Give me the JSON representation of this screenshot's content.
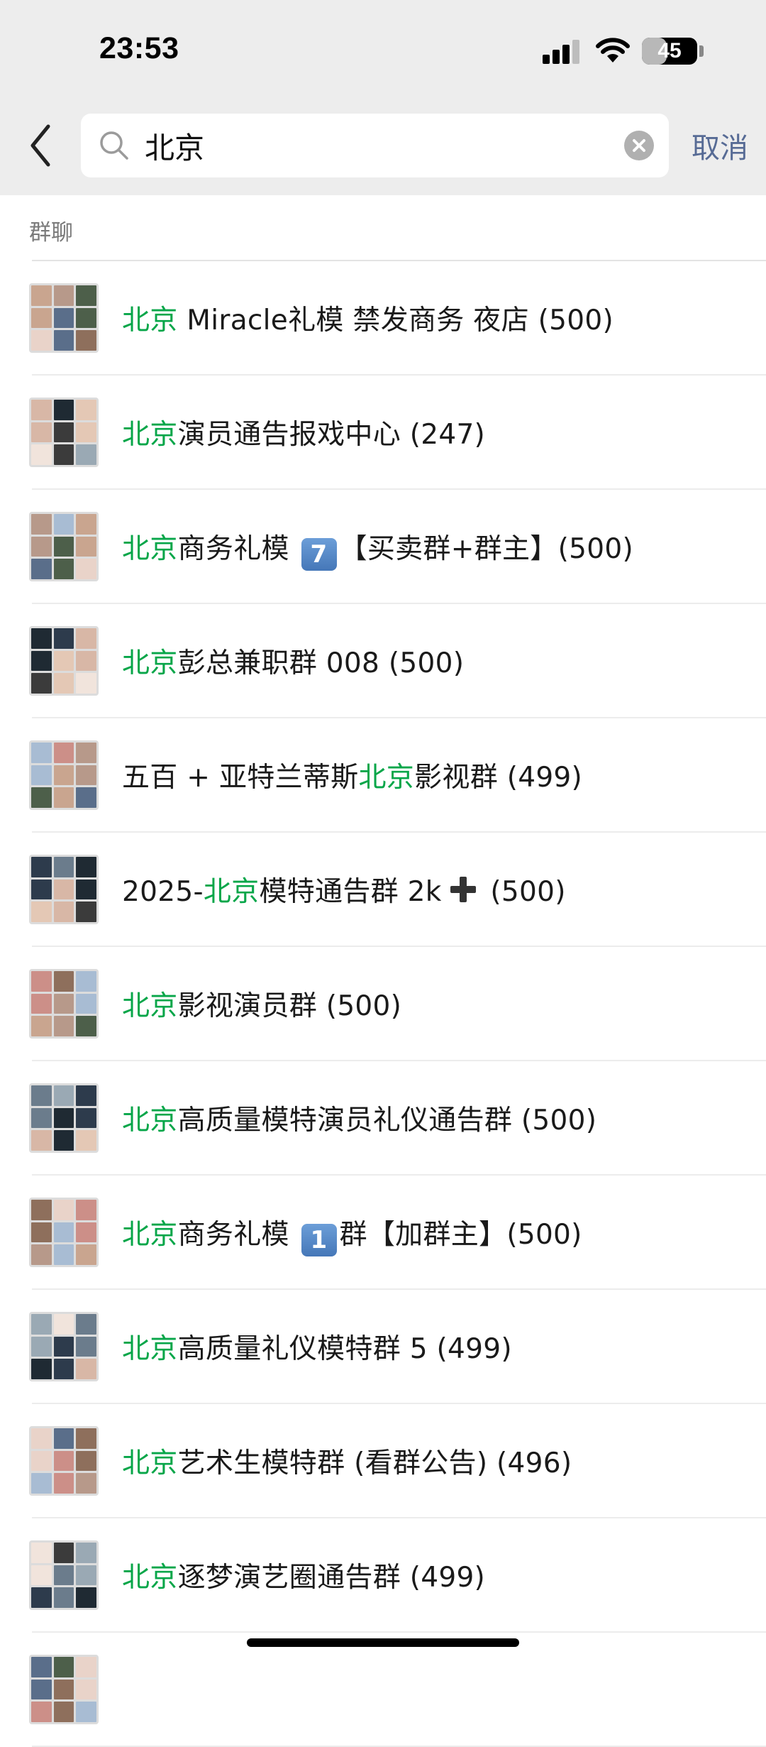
{
  "status_bar": {
    "time": "23:53",
    "battery": "45",
    "battery_level": 0.45
  },
  "search": {
    "query": "北京",
    "cancel_label": "取消"
  },
  "section": {
    "title": "群聊"
  },
  "results": [
    {
      "parts": [
        {
          "text": "北京",
          "hl": true
        },
        {
          "text": " Miracle礼模 禁发商务 夜店 (500)"
        }
      ]
    },
    {
      "parts": [
        {
          "text": "北京",
          "hl": true
        },
        {
          "text": "演员通告报戏中心 (247)"
        }
      ]
    },
    {
      "parts": [
        {
          "text": "北京",
          "hl": true
        },
        {
          "text": "商务礼模 "
        },
        {
          "badge": "7"
        },
        {
          "text": "【买卖群+群主】(500)"
        }
      ]
    },
    {
      "parts": [
        {
          "text": "北京",
          "hl": true
        },
        {
          "text": "彭总兼职群 008 (500)"
        }
      ]
    },
    {
      "parts": [
        {
          "text": "五百 + 亚特兰蒂斯"
        },
        {
          "text": "北京",
          "hl": true
        },
        {
          "text": "影视群 (499)"
        }
      ]
    },
    {
      "parts": [
        {
          "text": "2025-"
        },
        {
          "text": "北京",
          "hl": true
        },
        {
          "text": "模特通告群 2k"
        },
        {
          "plus": true
        },
        {
          "text": " (500)"
        }
      ]
    },
    {
      "parts": [
        {
          "text": "北京",
          "hl": true
        },
        {
          "text": "影视演员群 (500)"
        }
      ]
    },
    {
      "parts": [
        {
          "text": "北京",
          "hl": true
        },
        {
          "text": "高质量模特演员礼仪通告群 (500)"
        }
      ]
    },
    {
      "parts": [
        {
          "text": "北京",
          "hl": true
        },
        {
          "text": "商务礼模 "
        },
        {
          "badge": "1"
        },
        {
          "text": "群【加群主】(500)"
        }
      ]
    },
    {
      "parts": [
        {
          "text": "北京",
          "hl": true
        },
        {
          "text": "高质量礼仪模特群 5 (499)"
        }
      ]
    },
    {
      "parts": [
        {
          "text": "北京",
          "hl": true
        },
        {
          "text": "艺术生模特群 (看群公告) (496)"
        }
      ]
    },
    {
      "parts": [
        {
          "text": "北京",
          "hl": true
        },
        {
          "text": "逐梦演艺圈通告群 (499)"
        }
      ]
    },
    {
      "parts": []
    }
  ],
  "colors": {
    "highlight": "#07a649",
    "link": "#576b95",
    "avatar_palette": [
      "#c9a58f",
      "#3b3b3b",
      "#e9d3c9",
      "#6b7c8c",
      "#a8bcd3",
      "#d8b7a6",
      "#4d5f4a",
      "#f1e4dc",
      "#8e6f5c",
      "#2d3b4c",
      "#b7998a",
      "#e4c8b5",
      "#5a6e8a",
      "#9aa9b4",
      "#cc8f88",
      "#1f2a33"
    ]
  }
}
